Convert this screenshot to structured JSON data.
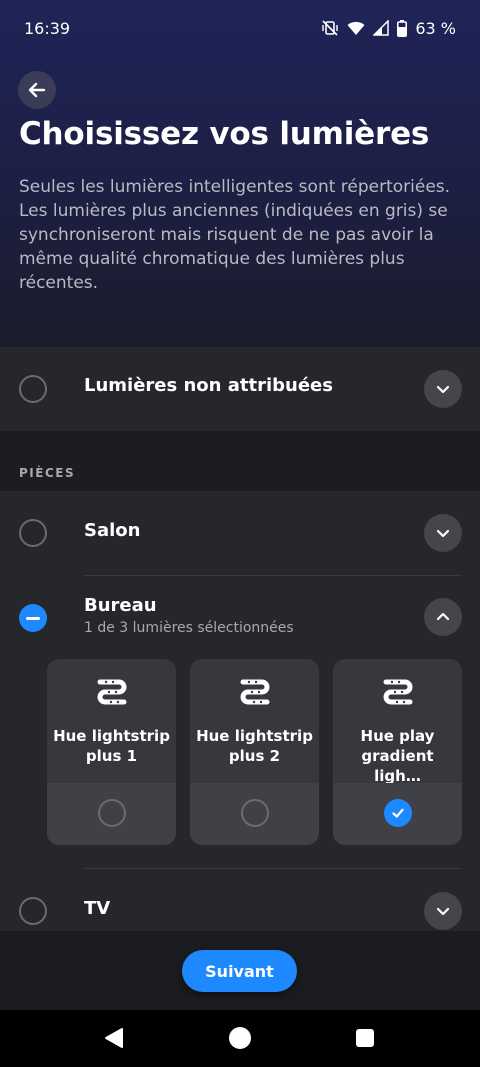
{
  "status_bar": {
    "time": "16:39",
    "battery": "63 %",
    "icons": [
      "vibrate-off-icon",
      "wifi-icon",
      "signal-icon",
      "battery-icon"
    ]
  },
  "header": {
    "title": "Choisissez vos lumières",
    "description": "Seules les lumières intelligentes sont répertoriées. Les lumières plus anciennes (indiquées en gris) se synchroniseront mais risquent de ne pas avoir la même qualité chromatique des lumières plus récentes."
  },
  "unassigned": {
    "label": "Lumières non attribuées"
  },
  "rooms_section": {
    "header": "PIÈCES"
  },
  "rooms": [
    {
      "name": "Salon",
      "state": "unselected",
      "expanded": false
    },
    {
      "name": "Bureau",
      "state": "partial",
      "subtitle": "1 de 3 lumières sélectionnées",
      "expanded": true,
      "lights": [
        {
          "name": "Hue lightstrip plus 1",
          "selected": false
        },
        {
          "name": "Hue lightstrip plus 2",
          "selected": false
        },
        {
          "name": "Hue play gradient ligh…",
          "selected": true
        }
      ]
    },
    {
      "name": "TV",
      "state": "unselected",
      "expanded": false
    }
  ],
  "footer": {
    "next_label": "Suivant"
  },
  "colors": {
    "accent": "#1e88ff",
    "background": "#1c1d21",
    "surface": "#26272b",
    "header_gradient_top": "#1f2458"
  }
}
